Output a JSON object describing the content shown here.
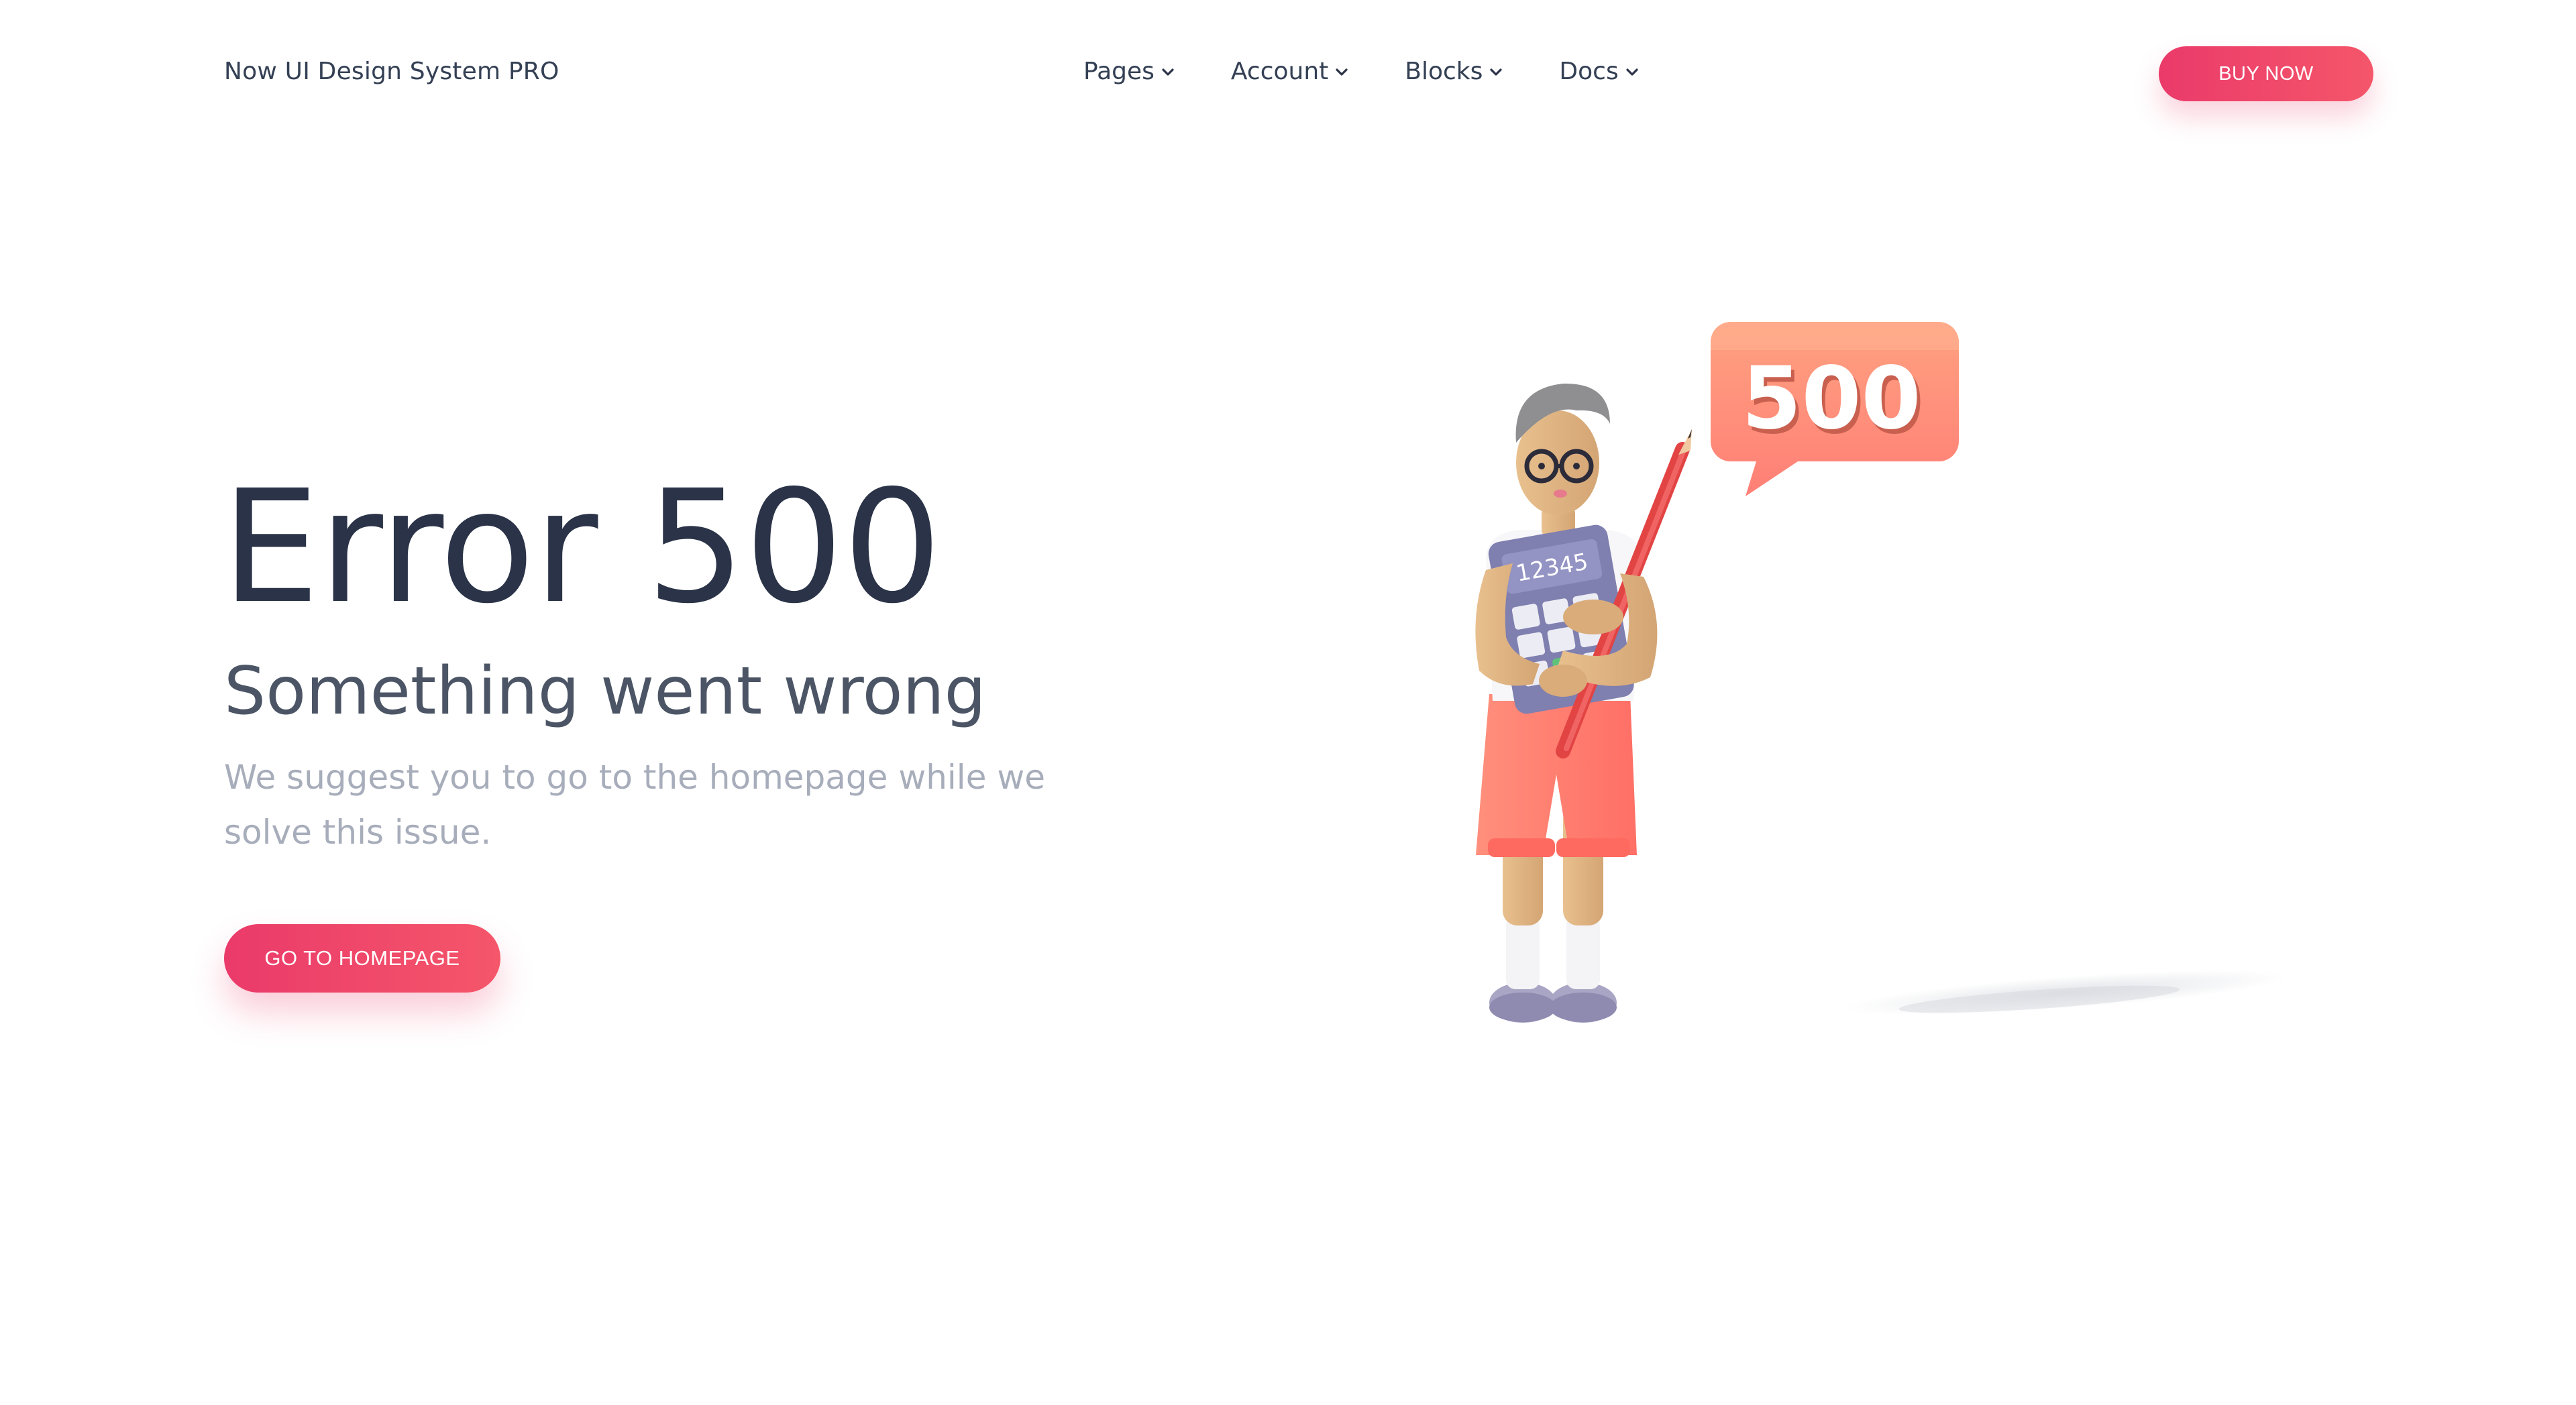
{
  "navbar": {
    "brand": "Now UI Design System PRO",
    "links": [
      {
        "label": "Pages"
      },
      {
        "label": "Account"
      },
      {
        "label": "Blocks"
      },
      {
        "label": "Docs"
      }
    ],
    "cta_label": "BUY NOW"
  },
  "hero": {
    "title": "Error 500",
    "subtitle": "Something went wrong",
    "description": "We suggest you to go to the homepage while we solve this issue.",
    "button_label": "GO TO HOMEPAGE"
  },
  "illustration": {
    "bubble_text": "500",
    "calculator_display": "12345"
  },
  "colors": {
    "accent": "#ea3a6a",
    "text_dark": "#2a3347",
    "text_muted": "#a7adba",
    "bubble": "#ff8d78"
  },
  "icons": {
    "nav_dropdown": "chevron-down-icon"
  }
}
